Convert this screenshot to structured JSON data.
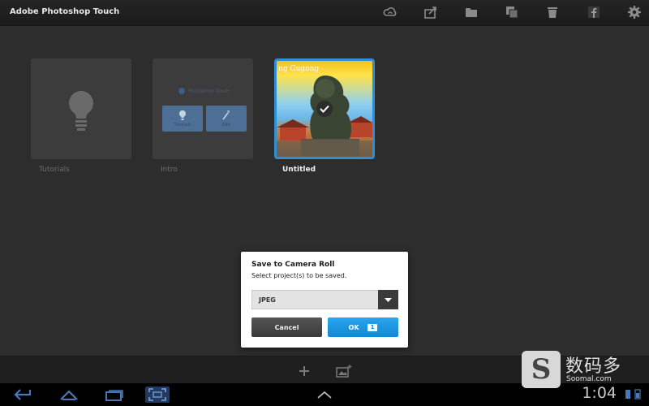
{
  "header": {
    "title": "Adobe Photoshop Touch",
    "icons": [
      "creative-cloud-icon",
      "share-icon",
      "folder-icon",
      "duplicate-icon",
      "trash-icon",
      "facebook-icon",
      "settings-icon"
    ]
  },
  "projects": [
    {
      "label": "Tutorials",
      "icon": "lightbulb-icon"
    },
    {
      "label": "Intro",
      "header": "Photoshop Touch",
      "buttons": [
        "Tutorials",
        "Edit"
      ]
    },
    {
      "label": "Untitled",
      "overlay_text": "ng Gugong",
      "selected": true
    }
  ],
  "dialog": {
    "title": "Save to Camera Roll",
    "subtitle": "Select project(s) to be saved.",
    "format": "JPEG",
    "cancel_label": "Cancel",
    "ok_label": "OK",
    "ok_count": "1"
  },
  "bottom_toolbar": {
    "icons": [
      "add-icon",
      "import-image-icon"
    ]
  },
  "system_bar": {
    "clock": "1:04",
    "nav_icons": [
      "back-icon",
      "home-icon",
      "recent-apps-icon",
      "screenshot-icon",
      "expand-icon"
    ]
  },
  "watermark": {
    "logo": "S",
    "chinese": "数码多",
    "url": "Soomal.com"
  },
  "colors": {
    "accent": "#2d8fd6",
    "ok_button": "#1288d6",
    "background": "#2d2d2d"
  }
}
